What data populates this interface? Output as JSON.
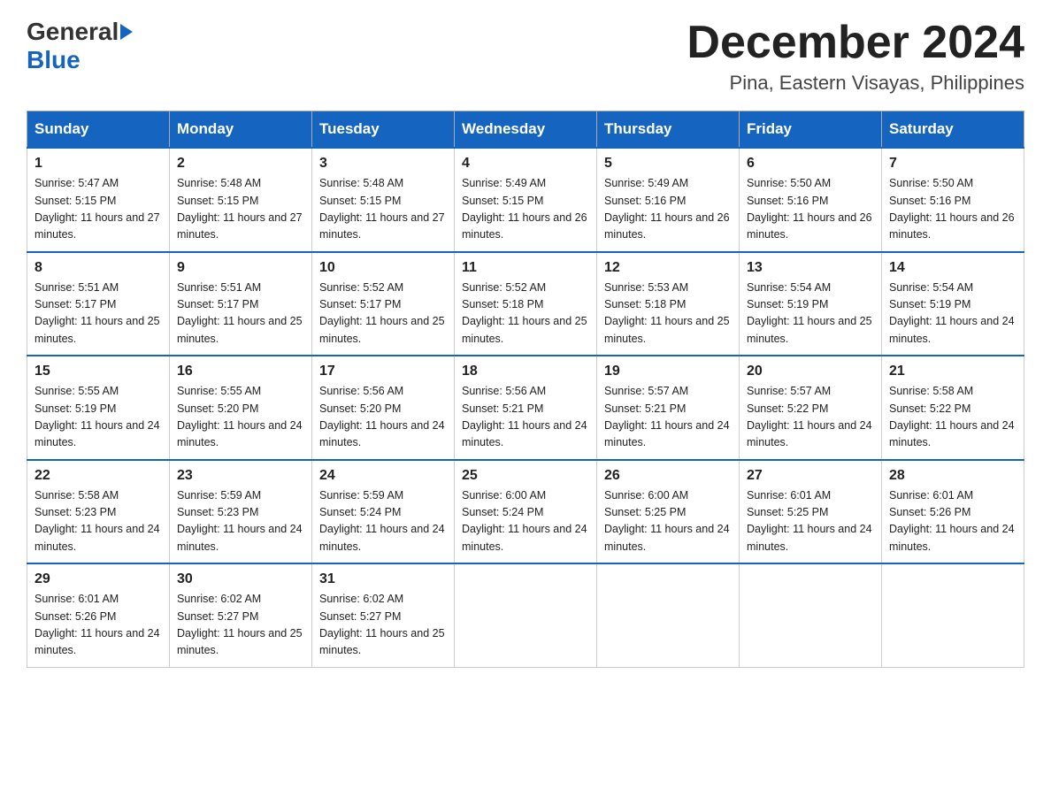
{
  "logo": {
    "general": "General",
    "blue": "Blue"
  },
  "header": {
    "month": "December 2024",
    "location": "Pina, Eastern Visayas, Philippines"
  },
  "days_of_week": [
    "Sunday",
    "Monday",
    "Tuesday",
    "Wednesday",
    "Thursday",
    "Friday",
    "Saturday"
  ],
  "weeks": [
    [
      {
        "day": "1",
        "sunrise": "5:47 AM",
        "sunset": "5:15 PM",
        "daylight": "11 hours and 27 minutes."
      },
      {
        "day": "2",
        "sunrise": "5:48 AM",
        "sunset": "5:15 PM",
        "daylight": "11 hours and 27 minutes."
      },
      {
        "day": "3",
        "sunrise": "5:48 AM",
        "sunset": "5:15 PM",
        "daylight": "11 hours and 27 minutes."
      },
      {
        "day": "4",
        "sunrise": "5:49 AM",
        "sunset": "5:15 PM",
        "daylight": "11 hours and 26 minutes."
      },
      {
        "day": "5",
        "sunrise": "5:49 AM",
        "sunset": "5:16 PM",
        "daylight": "11 hours and 26 minutes."
      },
      {
        "day": "6",
        "sunrise": "5:50 AM",
        "sunset": "5:16 PM",
        "daylight": "11 hours and 26 minutes."
      },
      {
        "day": "7",
        "sunrise": "5:50 AM",
        "sunset": "5:16 PM",
        "daylight": "11 hours and 26 minutes."
      }
    ],
    [
      {
        "day": "8",
        "sunrise": "5:51 AM",
        "sunset": "5:17 PM",
        "daylight": "11 hours and 25 minutes."
      },
      {
        "day": "9",
        "sunrise": "5:51 AM",
        "sunset": "5:17 PM",
        "daylight": "11 hours and 25 minutes."
      },
      {
        "day": "10",
        "sunrise": "5:52 AM",
        "sunset": "5:17 PM",
        "daylight": "11 hours and 25 minutes."
      },
      {
        "day": "11",
        "sunrise": "5:52 AM",
        "sunset": "5:18 PM",
        "daylight": "11 hours and 25 minutes."
      },
      {
        "day": "12",
        "sunrise": "5:53 AM",
        "sunset": "5:18 PM",
        "daylight": "11 hours and 25 minutes."
      },
      {
        "day": "13",
        "sunrise": "5:54 AM",
        "sunset": "5:19 PM",
        "daylight": "11 hours and 25 minutes."
      },
      {
        "day": "14",
        "sunrise": "5:54 AM",
        "sunset": "5:19 PM",
        "daylight": "11 hours and 24 minutes."
      }
    ],
    [
      {
        "day": "15",
        "sunrise": "5:55 AM",
        "sunset": "5:19 PM",
        "daylight": "11 hours and 24 minutes."
      },
      {
        "day": "16",
        "sunrise": "5:55 AM",
        "sunset": "5:20 PM",
        "daylight": "11 hours and 24 minutes."
      },
      {
        "day": "17",
        "sunrise": "5:56 AM",
        "sunset": "5:20 PM",
        "daylight": "11 hours and 24 minutes."
      },
      {
        "day": "18",
        "sunrise": "5:56 AM",
        "sunset": "5:21 PM",
        "daylight": "11 hours and 24 minutes."
      },
      {
        "day": "19",
        "sunrise": "5:57 AM",
        "sunset": "5:21 PM",
        "daylight": "11 hours and 24 minutes."
      },
      {
        "day": "20",
        "sunrise": "5:57 AM",
        "sunset": "5:22 PM",
        "daylight": "11 hours and 24 minutes."
      },
      {
        "day": "21",
        "sunrise": "5:58 AM",
        "sunset": "5:22 PM",
        "daylight": "11 hours and 24 minutes."
      }
    ],
    [
      {
        "day": "22",
        "sunrise": "5:58 AM",
        "sunset": "5:23 PM",
        "daylight": "11 hours and 24 minutes."
      },
      {
        "day": "23",
        "sunrise": "5:59 AM",
        "sunset": "5:23 PM",
        "daylight": "11 hours and 24 minutes."
      },
      {
        "day": "24",
        "sunrise": "5:59 AM",
        "sunset": "5:24 PM",
        "daylight": "11 hours and 24 minutes."
      },
      {
        "day": "25",
        "sunrise": "6:00 AM",
        "sunset": "5:24 PM",
        "daylight": "11 hours and 24 minutes."
      },
      {
        "day": "26",
        "sunrise": "6:00 AM",
        "sunset": "5:25 PM",
        "daylight": "11 hours and 24 minutes."
      },
      {
        "day": "27",
        "sunrise": "6:01 AM",
        "sunset": "5:25 PM",
        "daylight": "11 hours and 24 minutes."
      },
      {
        "day": "28",
        "sunrise": "6:01 AM",
        "sunset": "5:26 PM",
        "daylight": "11 hours and 24 minutes."
      }
    ],
    [
      {
        "day": "29",
        "sunrise": "6:01 AM",
        "sunset": "5:26 PM",
        "daylight": "11 hours and 24 minutes."
      },
      {
        "day": "30",
        "sunrise": "6:02 AM",
        "sunset": "5:27 PM",
        "daylight": "11 hours and 25 minutes."
      },
      {
        "day": "31",
        "sunrise": "6:02 AM",
        "sunset": "5:27 PM",
        "daylight": "11 hours and 25 minutes."
      },
      null,
      null,
      null,
      null
    ]
  ]
}
